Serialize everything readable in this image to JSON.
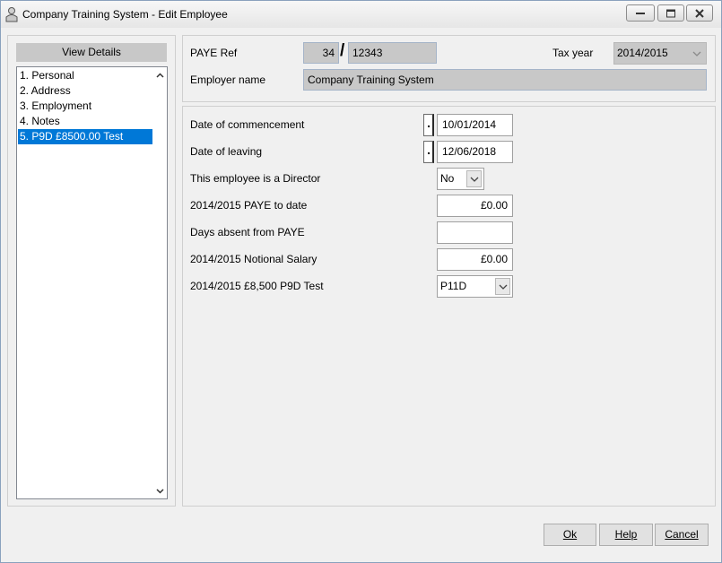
{
  "window": {
    "title": "Company Training System - Edit Employee"
  },
  "sidebar": {
    "header": "View Details",
    "items": [
      {
        "label": "1. Personal",
        "selected": false
      },
      {
        "label": "2. Address",
        "selected": false
      },
      {
        "label": "3. Employment",
        "selected": false
      },
      {
        "label": "4. Notes",
        "selected": false
      },
      {
        "label": "5. P9D £8500.00 Test",
        "selected": true
      }
    ]
  },
  "info": {
    "paye_ref_label": "PAYE Ref",
    "paye_ref_office": "34",
    "paye_ref_separator": "/",
    "paye_ref_number": "12343",
    "tax_year_label": "Tax year",
    "tax_year_value": "2014/2015",
    "employer_name_label": "Employer name",
    "employer_name_value": "Company Training System"
  },
  "form": {
    "commencement_label": "Date of commencement",
    "commencement_value": "10/01/2014",
    "leaving_label": "Date of leaving",
    "leaving_value": "12/06/2018",
    "director_label": "This employee is a Director",
    "director_value": "No",
    "paye_to_date_label": "2014/2015 PAYE to date",
    "paye_to_date_value": "£0.00",
    "days_absent_label": "Days absent from PAYE",
    "days_absent_value": "",
    "notional_salary_label": "2014/2015 Notional Salary",
    "notional_salary_value": "£0.00",
    "p9d_test_label": "2014/2015 £8,500 P9D Test",
    "p9d_test_value": "P11D"
  },
  "footer": {
    "ok_label": "Ok",
    "help_label": "Help",
    "cancel_label": "Cancel"
  },
  "colors": {
    "selection": "#0078d7",
    "readonly_bg": "#c8c8c8",
    "window_bg": "#f0f0f0"
  }
}
